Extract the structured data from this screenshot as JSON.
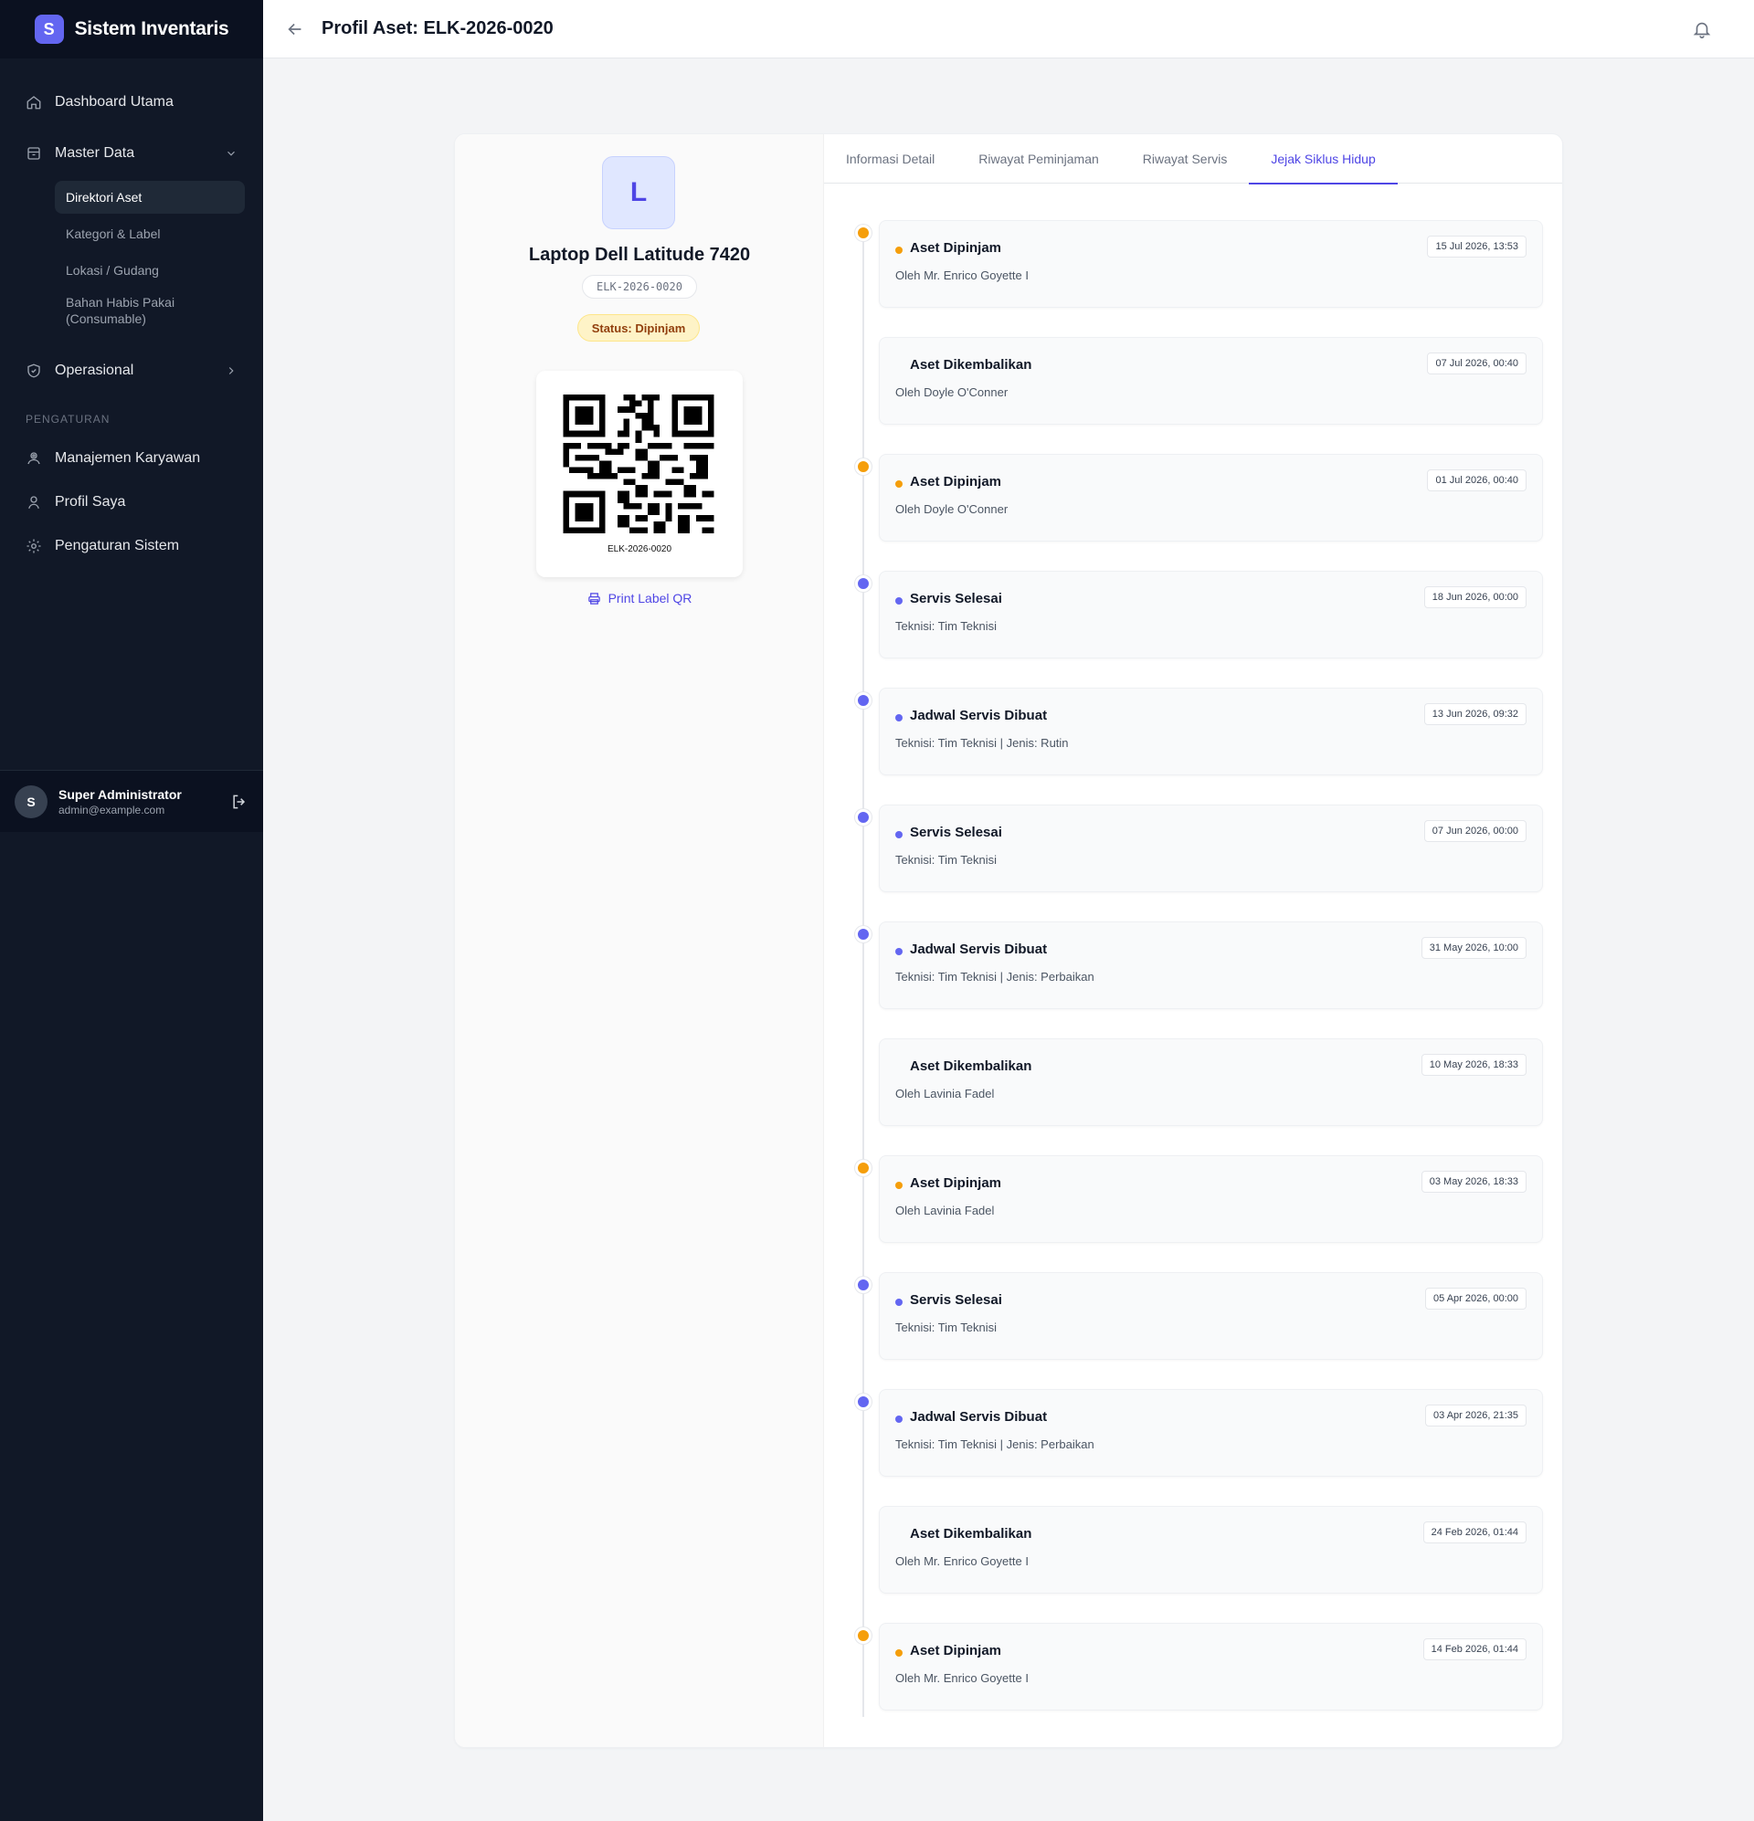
{
  "app": {
    "logo_letter": "S",
    "name": "Sistem Inventaris"
  },
  "sidebar": {
    "nav": [
      {
        "label": "Dashboard Utama",
        "icon": "home-icon"
      },
      {
        "label": "Master Data",
        "icon": "archive-icon"
      }
    ],
    "master_sub": [
      "Direktori Aset",
      "Kategori & Label",
      "Lokasi / Gudang",
      "Bahan Habis Pakai (Consumable)"
    ],
    "operational": {
      "label": "Operasional",
      "icon": "shield-icon"
    },
    "section_label": "PENGATURAN",
    "settings": [
      {
        "label": "Manajemen Karyawan",
        "icon": "users-icon"
      },
      {
        "label": "Profil Saya",
        "icon": "user-icon"
      },
      {
        "label": "Pengaturan Sistem",
        "icon": "gear-icon"
      }
    ],
    "user": {
      "initial": "S",
      "name": "Super Administrator",
      "email": "admin@example.com"
    }
  },
  "header": {
    "title": "Profil Aset: ELK-2026-0020"
  },
  "asset": {
    "letter": "L",
    "name": "Laptop Dell Latitude 7420",
    "code": "ELK-2026-0020",
    "status": "Status: Dipinjam",
    "qr_caption": "ELK-2026-0020",
    "print_label": "Print Label QR"
  },
  "tabs": [
    "Informasi Detail",
    "Riwayat Peminjaman",
    "Riwayat Servis",
    "Jejak Siklus Hidup"
  ],
  "active_tab": "Jejak Siklus Hidup",
  "colors": {
    "accent": "#4f46e5",
    "loan": "#f59e0b",
    "service": "#6366f1"
  },
  "timeline": [
    {
      "title": "Aset Dipinjam",
      "desc": "Oleh Mr. Enrico Goyette I",
      "date": "15 Jul 2026, 13:53",
      "kind": "orange"
    },
    {
      "title": "Aset Dikembalikan",
      "desc": "Oleh Doyle O'Conner",
      "date": "07 Jul 2026, 00:40",
      "kind": "none"
    },
    {
      "title": "Aset Dipinjam",
      "desc": "Oleh Doyle O'Conner",
      "date": "01 Jul 2026, 00:40",
      "kind": "orange"
    },
    {
      "title": "Servis Selesai",
      "desc": "Teknisi: Tim Teknisi",
      "date": "18 Jun 2026, 00:00",
      "kind": "indigo"
    },
    {
      "title": "Jadwal Servis Dibuat",
      "desc": "Teknisi: Tim Teknisi | Jenis: Rutin",
      "date": "13 Jun 2026, 09:32",
      "kind": "indigo"
    },
    {
      "title": "Servis Selesai",
      "desc": "Teknisi: Tim Teknisi",
      "date": "07 Jun 2026, 00:00",
      "kind": "indigo"
    },
    {
      "title": "Jadwal Servis Dibuat",
      "desc": "Teknisi: Tim Teknisi | Jenis: Perbaikan",
      "date": "31 May 2026, 10:00",
      "kind": "indigo"
    },
    {
      "title": "Aset Dikembalikan",
      "desc": "Oleh Lavinia Fadel",
      "date": "10 May 2026, 18:33",
      "kind": "none"
    },
    {
      "title": "Aset Dipinjam",
      "desc": "Oleh Lavinia Fadel",
      "date": "03 May 2026, 18:33",
      "kind": "orange"
    },
    {
      "title": "Servis Selesai",
      "desc": "Teknisi: Tim Teknisi",
      "date": "05 Apr 2026, 00:00",
      "kind": "indigo"
    },
    {
      "title": "Jadwal Servis Dibuat",
      "desc": "Teknisi: Tim Teknisi | Jenis: Perbaikan",
      "date": "03 Apr 2026, 21:35",
      "kind": "indigo"
    },
    {
      "title": "Aset Dikembalikan",
      "desc": "Oleh Mr. Enrico Goyette I",
      "date": "24 Feb 2026, 01:44",
      "kind": "none"
    },
    {
      "title": "Aset Dipinjam",
      "desc": "Oleh Mr. Enrico Goyette I",
      "date": "14 Feb 2026, 01:44",
      "kind": "orange"
    }
  ]
}
